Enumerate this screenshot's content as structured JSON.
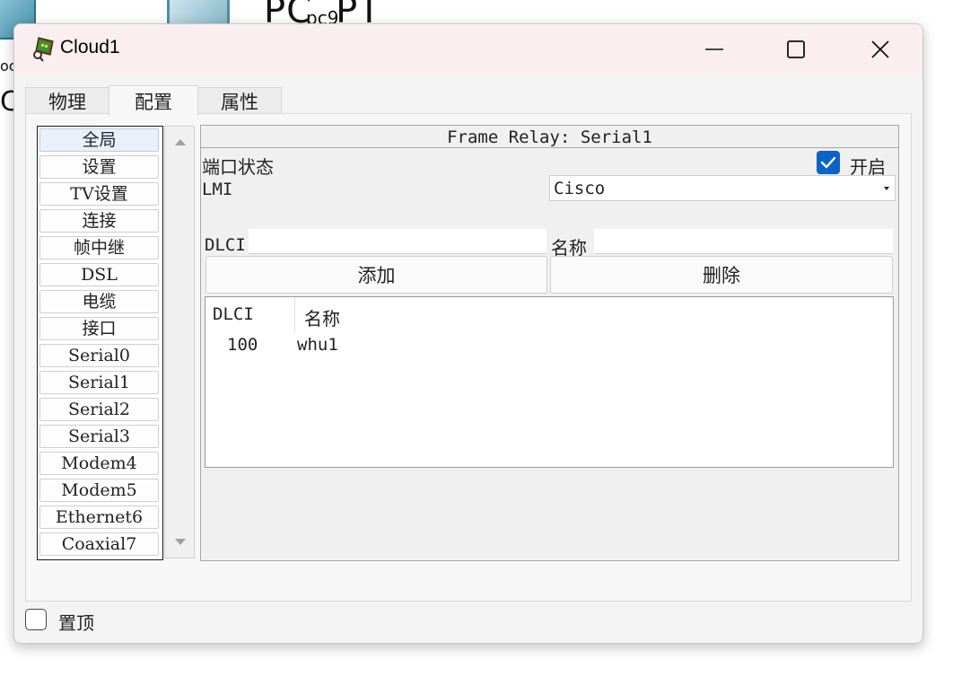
{
  "desktop": {
    "label_big": "PC",
    "label_suffix": "PT",
    "label_small": "pc9",
    "fragment_a": "oc",
    "fragment_b": "C"
  },
  "window": {
    "title": "Cloud1",
    "icon": "cloud-device-icon",
    "controls": {
      "minimize": "minimize-icon",
      "maximize": "maximize-icon",
      "close": "close-icon"
    }
  },
  "tabs": [
    {
      "label": "物理",
      "active": false
    },
    {
      "label": "配置",
      "active": true
    },
    {
      "label": "属性",
      "active": false
    }
  ],
  "sidebar": {
    "items": [
      "全局",
      "设置",
      "TV设置",
      "连接",
      "帧中继",
      "DSL",
      "电缆",
      "接口",
      "Serial0",
      "Serial1",
      "Serial2",
      "Serial3",
      "Modem4",
      "Modem5",
      "Ethernet6",
      "Coaxial7"
    ],
    "selected_index": 0
  },
  "panel": {
    "title": "Frame Relay: Serial1",
    "port_status_label": "端口状态",
    "on_label": "开启",
    "on_checked": true,
    "lmi_label": "LMI",
    "lmi_value": "Cisco",
    "dlci_label": "DLCI",
    "dlci_value": "",
    "name_label": "名称",
    "name_value": "",
    "add_button": "添加",
    "delete_button": "删除",
    "table": {
      "columns": [
        "DLCI",
        "名称"
      ],
      "rows": [
        {
          "dlci": "100",
          "name": "whu1"
        }
      ]
    }
  },
  "footer": {
    "always_on_top_label": "置顶",
    "always_on_top_checked": false
  },
  "colors": {
    "accent": "#0b63c6",
    "titlebar": "#fbeef0"
  }
}
